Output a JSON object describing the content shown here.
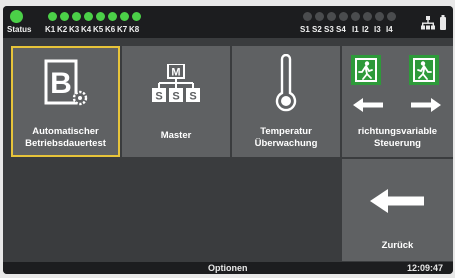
{
  "status_bar": {
    "status_label": "Status",
    "k_labels": [
      "K1",
      "K2",
      "K3",
      "K4",
      "K5",
      "K6",
      "K7",
      "K8"
    ],
    "s_labels": [
      "S1",
      "S2",
      "S3",
      "S4",
      "I1",
      "I2",
      "I3",
      "I4"
    ],
    "k_led_color": "#4bd048",
    "s_led_color": "#4a4c4e",
    "icons": [
      "network-icon",
      "battery-icon"
    ]
  },
  "tiles": [
    {
      "id": "automatic-test",
      "caption_lines": [
        "Automatischer",
        "Betriebsdauertest"
      ],
      "selected": true,
      "icon": "b-document-gear-icon"
    },
    {
      "id": "master",
      "caption_lines": [
        "Master"
      ],
      "selected": false,
      "icon": "master-hierarchy-icon"
    },
    {
      "id": "temperature",
      "caption_lines": [
        "Temperatur",
        "Überwachung"
      ],
      "selected": false,
      "icon": "thermometer-icon"
    },
    {
      "id": "directional",
      "caption_lines": [
        "richtungsvariable",
        "Steuerung"
      ],
      "selected": false,
      "icon": "emergency-exit-arrows-icon"
    },
    {
      "id": "back",
      "caption_lines": [
        "Zurück"
      ],
      "selected": false,
      "icon": "arrow-left-icon"
    }
  ],
  "bottom_bar": {
    "title": "Optionen",
    "time": "12:09:47"
  },
  "colors": {
    "selection": "#e7c43a",
    "exit_sign_green": "#2e9a3a"
  }
}
